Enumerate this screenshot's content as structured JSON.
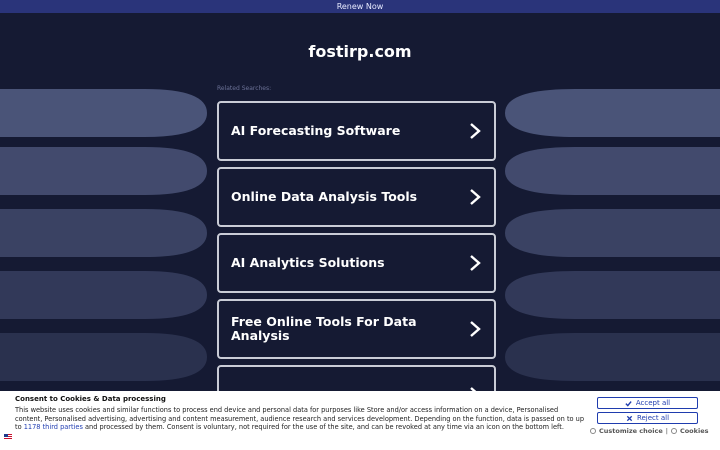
{
  "topbar": {
    "renew_label": "Renew Now"
  },
  "site": {
    "title": "fostirp.com"
  },
  "related": {
    "heading": "Related Searches:"
  },
  "cards": [
    {
      "label": "AI Forecasting Software"
    },
    {
      "label": "Online Data Analysis Tools"
    },
    {
      "label": "AI Analytics Solutions"
    },
    {
      "label": "Free Online Tools For Data Analysis"
    },
    {
      "label": ""
    }
  ],
  "consent": {
    "title": "Consent to Cookies & Data processing",
    "text_before": "This website uses cookies and similar functions to process end device and personal data for purposes like Store and/or access information on a device, Personalised content, Personalised advertising, advertising and content measurement, audience research and services development. Depending on the function, data is passed on to up to ",
    "link_text": "1178 third parties",
    "text_after": " and processed by them. Consent is voluntary, not required for the use of the site, and can be revoked at any time via an icon on the bottom left.",
    "accept_label": "Accept all",
    "reject_label": "Reject all",
    "customize_label": "Customize choice",
    "separator": "|",
    "cookies_label": "Cookies"
  },
  "colors": {
    "background": "#151a33",
    "topbar": "#2a347a",
    "card_border": "#c9ccd6",
    "accent": "#1f3cae"
  }
}
